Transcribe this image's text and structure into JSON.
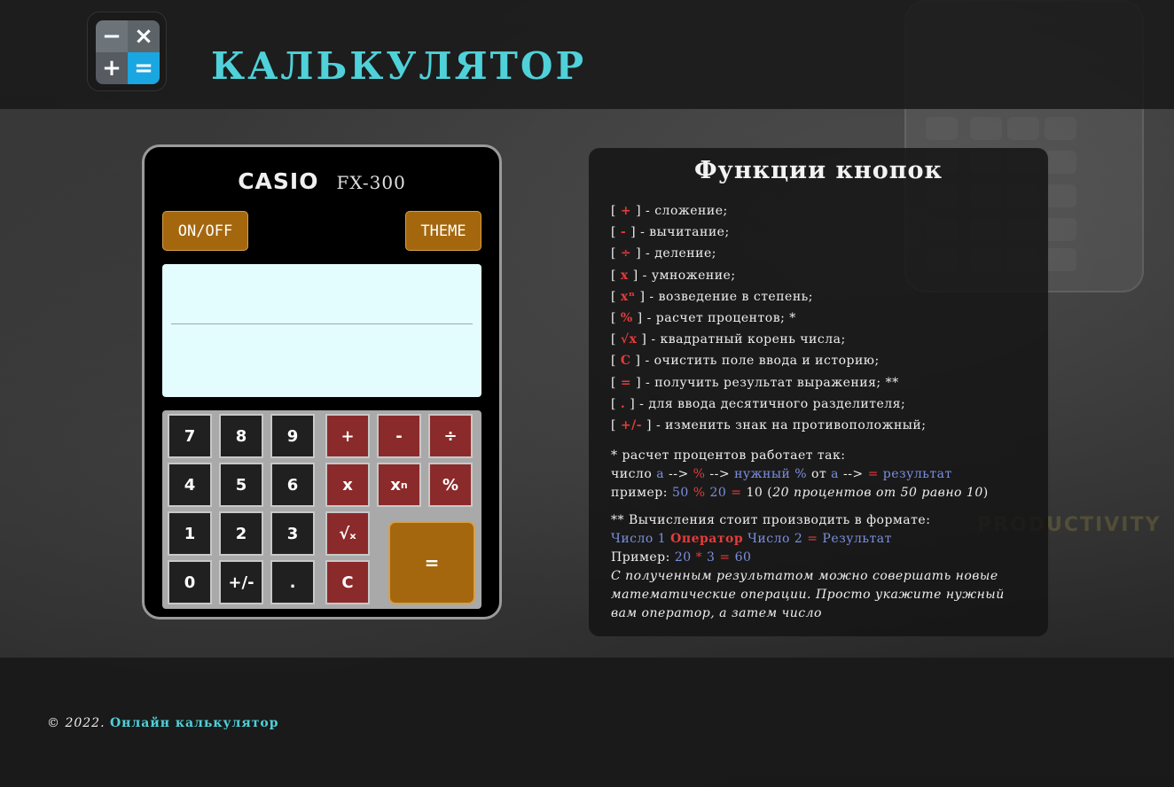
{
  "header": {
    "logo_icon": "calculator-app-icon",
    "logo_glyphs": [
      "−",
      "×",
      "+",
      "="
    ],
    "title": "КАЛЬКУЛЯТОР"
  },
  "calculator": {
    "brand": "CASIO",
    "model": "FX-300",
    "on_off_label": "ON/OFF",
    "theme_label": "THEME",
    "history": "",
    "current": "",
    "keys": {
      "k7": "7",
      "k8": "8",
      "k9": "9",
      "plus": "+",
      "minus": "-",
      "divide": "÷",
      "k4": "4",
      "k5": "5",
      "k6": "6",
      "multiply": "x",
      "power_base": "x",
      "power_exp": "n",
      "percent": "%",
      "k1": "1",
      "k2": "2",
      "k3": "3",
      "sqrt": "√ₓ",
      "k0": "0",
      "sign": "+/-",
      "dot": ".",
      "clear": "C",
      "equals": "="
    }
  },
  "help": {
    "title": "Функции кнопок",
    "items": [
      {
        "symbol": "+",
        "text": " - сложение;"
      },
      {
        "symbol": "-",
        "text": " - вычитание;"
      },
      {
        "symbol": "÷",
        "text": " - деление;"
      },
      {
        "symbol": "x",
        "text": " - умножение;"
      },
      {
        "symbol": "xⁿ",
        "text": " - возведение в степень;"
      },
      {
        "symbol": "%",
        "text": " - расчет процентов; *"
      },
      {
        "symbol": "√x",
        "text": " - квадратный корень числа;"
      },
      {
        "symbol": "C",
        "text": " - очистить поле ввода и историю;"
      },
      {
        "symbol": "=",
        "text": " - получить результат выражения; **"
      },
      {
        "symbol": ".",
        "text": " - для ввода десятичного разделителя;"
      },
      {
        "symbol": "+/-",
        "text": " - изменить знак на противоположный;"
      }
    ],
    "note1": {
      "heading": "* расчет процентов работает так:",
      "l2_a": "число ",
      "l2_b": "a",
      "l2_c": " --> ",
      "l2_d": "%",
      "l2_e": " --> ",
      "l2_f": "нужный %",
      "l2_g": " от ",
      "l2_h": "a",
      "l2_i": " --> ",
      "l2_j": "=",
      "l2_k": " результат",
      "l3_a": "пример: ",
      "l3_b": "50",
      "l3_c": "%",
      "l3_d": "20",
      "l3_e": "=",
      "l3_f": " 10 (",
      "l3_g": "20 процентов от 50 равно 10",
      "l3_h": ")"
    },
    "note2": {
      "heading": "** Вычисления стоит производить в формате:",
      "l2_a": "Число 1 ",
      "l2_b": "Оператор",
      "l2_c": " Число 2 ",
      "l2_d": "=",
      "l2_e": " Результат",
      "l3_a": "Пример: ",
      "l3_b": "20",
      "l3_c": "*",
      "l3_d": "3",
      "l3_e": "=",
      "l3_f": "60",
      "l4": "С полученным результатом можно совершать новые математические операции. Просто укажите нужный вам оператор, а затем число"
    }
  },
  "footer": {
    "year": "© 2022.",
    "link": "Онлайн калькулятор"
  },
  "background": {
    "watermark": "PRODUCTIVITY"
  },
  "colors": {
    "accent": "#4fd1d9",
    "key_number": "#202020",
    "key_operator": "#8b2a2a",
    "key_action": "#a5670e",
    "display": "#e3fdff",
    "symbol_red": "#e53b3b",
    "note_blue": "#7b8fe0"
  }
}
